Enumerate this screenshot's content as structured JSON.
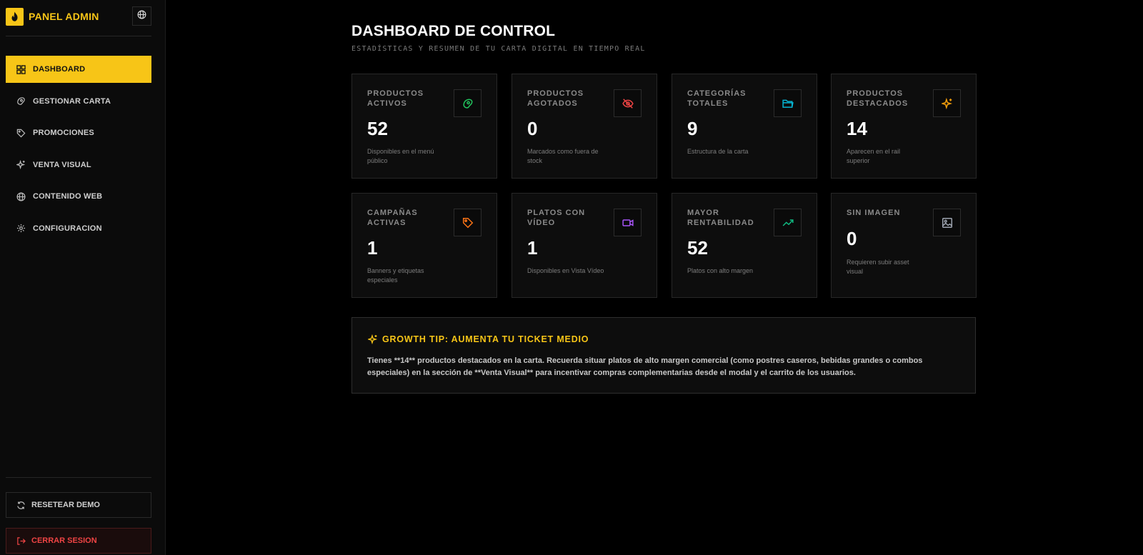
{
  "app": {
    "brand_title": "PANEL ADMIN",
    "accent_color": "#f7c517"
  },
  "sidebar": {
    "items": [
      {
        "label": "DASHBOARD",
        "icon": "grid-icon",
        "active": true
      },
      {
        "label": "GESTIONAR CARTA",
        "icon": "food-icon",
        "active": false
      },
      {
        "label": "PROMOCIONES",
        "icon": "tag-icon",
        "active": false
      },
      {
        "label": "VENTA VISUAL",
        "icon": "sparkles-icon",
        "active": false
      },
      {
        "label": "CONTENIDO WEB",
        "icon": "globe-icon",
        "active": false
      },
      {
        "label": "CONFIGURACION",
        "icon": "gear-icon",
        "active": false
      }
    ],
    "reset_label": "RESETEAR DEMO",
    "logout_label": "CERRAR SESION"
  },
  "header": {
    "title": "DASHBOARD DE CONTROL",
    "subtitle": "ESTADÍSTICAS Y RESUMEN DE TU CARTA DIGITAL EN TIEMPO REAL"
  },
  "stats": [
    {
      "label": "PRODUCTOS ACTIVOS",
      "value": "52",
      "desc": "Disponibles en el menú público",
      "icon": "food-icon",
      "color": "#22c55e"
    },
    {
      "label": "PRODUCTOS AGOTADOS",
      "value": "0",
      "desc": "Marcados como fuera de stock",
      "icon": "eye-off-icon",
      "color": "#ef4444"
    },
    {
      "label": "CATEGORÍAS TOTALES",
      "value": "9",
      "desc": "Estructura de la carta",
      "icon": "folder-icon",
      "color": "#06b6d4"
    },
    {
      "label": "PRODUCTOS DESTACADOS",
      "value": "14",
      "desc": "Aparecen en el rail superior",
      "icon": "sparkles-icon",
      "color": "#f59e0b"
    },
    {
      "label": "CAMPAÑAS ACTIVAS",
      "value": "1",
      "desc": "Banners y etiquetas especiales",
      "icon": "tag-icon",
      "color": "#f97316"
    },
    {
      "label": "PLATOS CON VÍDEO",
      "value": "1",
      "desc": "Disponibles en Vista Vídeo",
      "icon": "video-icon",
      "color": "#a855f7"
    },
    {
      "label": "MAYOR RENTABILIDAD",
      "value": "52",
      "desc": "Platos con alto margen",
      "icon": "trending-up-icon",
      "color": "#10b981"
    },
    {
      "label": "SIN IMAGEN",
      "value": "0",
      "desc": "Requieren subir asset visual",
      "icon": "image-icon",
      "color": "#9ca3af"
    }
  ],
  "tip": {
    "title": "GROWTH TIP: AUMENTA TU TICKET MEDIO",
    "text": "Tienes **14** productos destacados en la carta. Recuerda situar platos de alto margen comercial (como postres caseros, bebidas grandes o combos especiales) en la sección de **Venta Visual** para incentivar compras complementarias desde el modal y el carrito de los usuarios."
  }
}
